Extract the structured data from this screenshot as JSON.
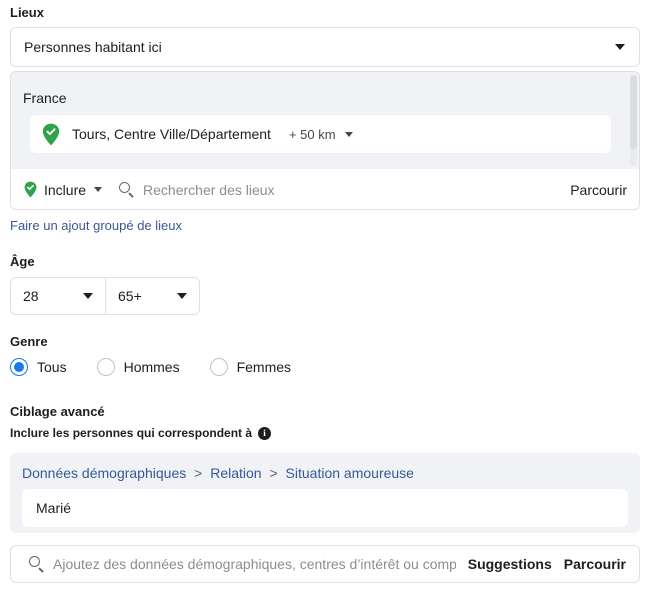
{
  "locations": {
    "label": "Lieux",
    "type_select": {
      "value": "Personnes habitant ici",
      "icon": "chevron-down-icon"
    },
    "country": "France",
    "entries": [
      {
        "icon": "map-pin-check-icon",
        "name": "Tours, Centre Ville/Département",
        "radius": "+ 50 km",
        "radius_caret": "chevron-down-icon"
      }
    ],
    "include_button": {
      "icon": "map-pin-check-icon",
      "label": "Inclure",
      "caret": "chevron-down-icon"
    },
    "search": {
      "icon": "search-icon",
      "placeholder": "Rechercher des lieux",
      "value": ""
    },
    "browse_label": "Parcourir",
    "bulk_link": "Faire un ajout groupé de lieux"
  },
  "age": {
    "label": "Âge",
    "min": "28",
    "max": "65+",
    "caret": "chevron-down-icon"
  },
  "gender": {
    "label": "Genre",
    "options": [
      {
        "label": "Tous",
        "selected": true
      },
      {
        "label": "Hommes",
        "selected": false
      },
      {
        "label": "Femmes",
        "selected": false
      }
    ]
  },
  "advanced": {
    "label": "Ciblage avancé",
    "subtitle": "Inclure les personnes qui correspondent à",
    "info_icon": "info-icon",
    "info_glyph": "i",
    "breadcrumb": [
      "Données démographiques",
      "Relation",
      "Situation amoureuse"
    ],
    "breadcrumb_separator": ">",
    "selected_value": "Marié",
    "search": {
      "icon": "search-icon",
      "placeholder": "Ajoutez des données démographiques, centres d’intérêt ou comportements",
      "value": ""
    },
    "suggestions_label": "Suggestions",
    "browse_label": "Parcourir"
  },
  "colors": {
    "accent_blue": "#1877f2",
    "link_blue": "#385898",
    "pin_green": "#31a24c",
    "panel_grey": "#f0f2f5",
    "border": "#dddfe2",
    "text": "#1c1e21",
    "placeholder": "#8a8d91"
  }
}
